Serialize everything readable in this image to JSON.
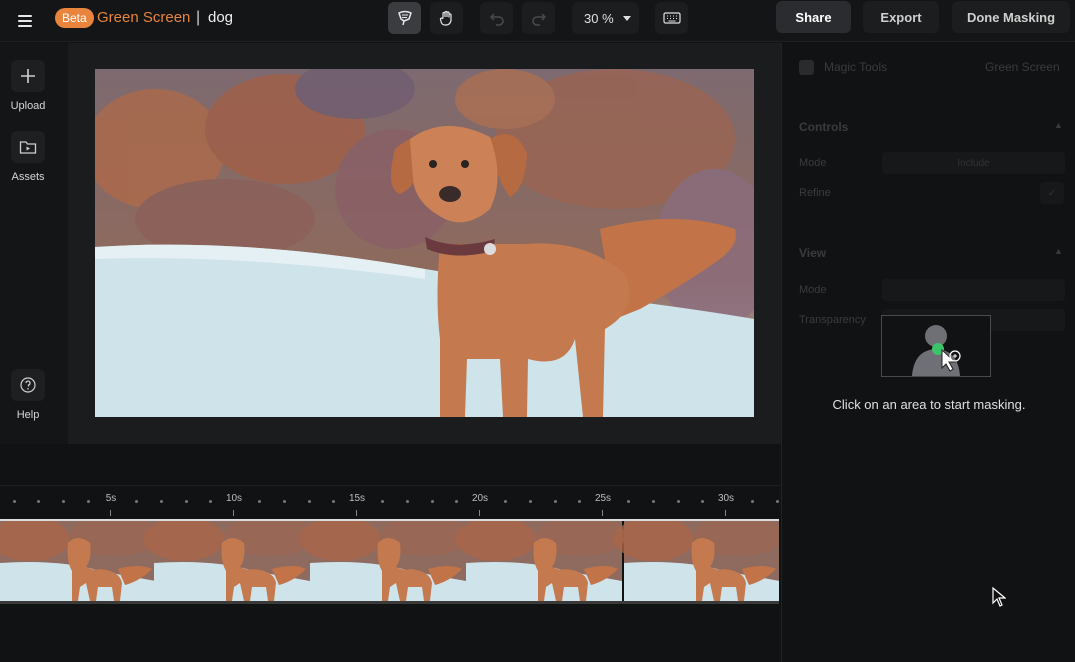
{
  "header": {
    "beta_label": "Beta",
    "app_name": "Green Screen",
    "separator": "|",
    "project_name": "dog",
    "zoom_value": "30 %",
    "share_label": "Share",
    "export_label": "Export",
    "done_label": "Done Masking"
  },
  "toolbar_icons": [
    "mask-brush-icon",
    "hand-icon",
    "undo-icon",
    "redo-icon",
    "keyboard-icon"
  ],
  "sidebar": {
    "items": [
      {
        "label": "Upload",
        "icon": "plus-icon"
      },
      {
        "label": "Assets",
        "icon": "folder-play-icon"
      },
      {
        "label": "Help",
        "icon": "question-icon"
      }
    ]
  },
  "timeline": {
    "ticks": [
      "5s",
      "10s",
      "15s",
      "20s",
      "25s",
      "30s"
    ]
  },
  "panel": {
    "magic_tools": "Magic Tools",
    "green_screen": "Green Screen",
    "controls": "Controls",
    "mode_label": "Mode",
    "mode_value": "Include",
    "refine_label": "Refine",
    "view": "View",
    "view_mode_label": "Mode",
    "transparency_label": "Transparency",
    "hint": "Click on an area to start masking."
  },
  "colors": {
    "accent": "#e8843c",
    "cursor_green": "#3cc46a"
  }
}
